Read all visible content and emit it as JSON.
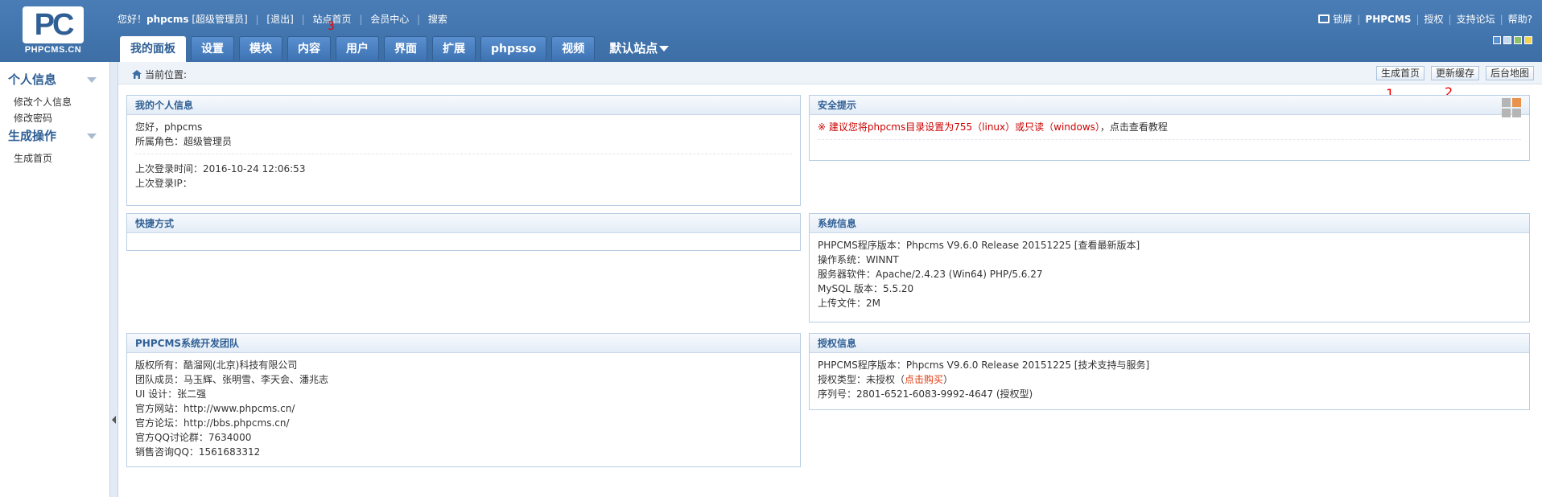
{
  "logo": {
    "mark": "PC",
    "text": "PHPCMS.CN"
  },
  "user_bar": {
    "greeting": "您好！",
    "username": "phpcms",
    "role": "[超级管理员]",
    "logout": "[退出]",
    "links": [
      "站点首页",
      "会员中心",
      "搜索"
    ]
  },
  "annotations": {
    "a3": "3",
    "a1": "1",
    "a2": "2"
  },
  "top_right": {
    "lock": "锁屏",
    "phpcms": "PHPCMS",
    "license": "授权",
    "forum": "支持论坛",
    "help": "帮助?"
  },
  "skin_colors": [
    "#5b8fd0",
    "#c6d8f0",
    "#8ec06c",
    "#f2d34f"
  ],
  "nav": {
    "tabs": [
      "我的面板",
      "设置",
      "模块",
      "内容",
      "用户",
      "界面",
      "扩展",
      "phpsso",
      "视频"
    ],
    "site_select": "默认站点"
  },
  "sidebar": {
    "sections": [
      {
        "title": "个人信息",
        "items": [
          "修改个人信息",
          "修改密码"
        ]
      },
      {
        "title": "生成操作",
        "items": [
          "生成首页"
        ]
      }
    ]
  },
  "crumb": {
    "label": "当前位置:",
    "buttons": [
      "生成首页",
      "更新缓存",
      "后台地图"
    ]
  },
  "panels": {
    "myinfo": {
      "title": "我的个人信息",
      "lines": [
        "您好，phpcms",
        "所属角色：超级管理员"
      ],
      "lines2": [
        "上次登录时间：2016-10-24 12:06:53",
        "上次登录IP："
      ]
    },
    "security": {
      "title": "安全提示",
      "warn": "※ 建议您将phpcms目录设置为755（linux）或只读（windows）",
      "suffix": "，点击查看教程"
    },
    "shortcut": {
      "title": "快捷方式"
    },
    "sysinfo": {
      "title": "系统信息",
      "lines": [
        "PHPCMS程序版本：Phpcms V9.6.0 Release 20151225 [查看最新版本]",
        "操作系统：WINNT",
        "服务器软件：Apache/2.4.23 (Win64) PHP/5.6.27",
        "MySQL 版本：5.5.20",
        "上传文件：2M"
      ]
    },
    "team": {
      "title": "PHPCMS系统开发团队",
      "lines": [
        "版权所有：酷溜网(北京)科技有限公司",
        "团队成员：马玉辉、张明雪、李天会、潘兆志",
        "UI 设计：张二强",
        "官方网站：http://www.phpcms.cn/",
        "官方论坛：http://bbs.phpcms.cn/",
        "官方QQ讨论群：7634000",
        "销售咨询QQ：1561683312"
      ]
    },
    "auth": {
      "title": "授权信息",
      "line1": "PHPCMS程序版本：Phpcms V9.6.0 Release 20151225 [技术支持与服务]",
      "type_label": "授权类型：未授权（",
      "buy": "点击购买",
      "type_end": "）",
      "serial": "序列号：2801-6521-6083-9992-4647 (授权型)"
    }
  }
}
